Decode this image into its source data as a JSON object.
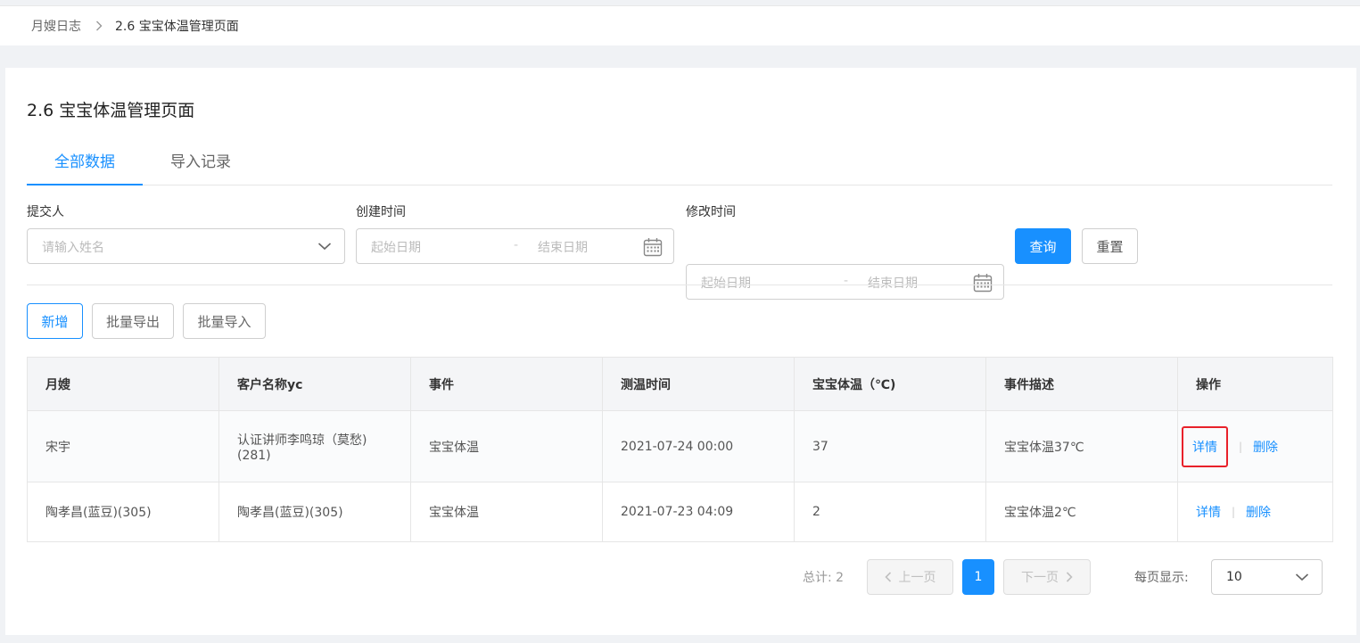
{
  "breadcrumb": {
    "home": "月嫂日志",
    "current": "2.6 宝宝体温管理页面"
  },
  "page": {
    "title": "2.6 宝宝体温管理页面"
  },
  "tabs": [
    {
      "label": "全部数据",
      "active": true
    },
    {
      "label": "导入记录",
      "active": false
    }
  ],
  "filters": {
    "submitter": {
      "label": "提交人",
      "placeholder": "请输入姓名"
    },
    "created": {
      "label": "创建时间",
      "start_placeholder": "起始日期",
      "end_placeholder": "结束日期",
      "separator": "-"
    },
    "modified": {
      "label": "修改时间",
      "start_placeholder": "起始日期",
      "end_placeholder": "结束日期",
      "separator": "-"
    },
    "query_label": "查询",
    "reset_label": "重置"
  },
  "toolbar": {
    "add_label": "新增",
    "export_label": "批量导出",
    "import_label": "批量导入"
  },
  "table": {
    "headers": [
      "月嫂",
      "客户名称yc",
      "事件",
      "测温时间",
      "宝宝体温（℃)",
      "事件描述",
      "操作"
    ],
    "rows": [
      {
        "nanny": "宋宇",
        "customer": "认证讲师李鸣琼（莫愁)(281)",
        "event": "宝宝体温",
        "time": "2021-07-24 00:00",
        "temp": "37",
        "desc": "宝宝体温37℃",
        "detail": "详情",
        "delete": "删除"
      },
      {
        "nanny": "陶孝昌(蓝豆)(305)",
        "customer": "陶孝昌(蓝豆)(305)",
        "event": "宝宝体温",
        "time": "2021-07-23 04:09",
        "temp": "2",
        "desc": "宝宝体温2℃",
        "detail": "详情",
        "delete": "删除"
      }
    ]
  },
  "pagination": {
    "total": "总计: 2",
    "prev": "上一页",
    "current": "1",
    "next": "下一页",
    "per_page_label": "每页显示:",
    "per_page_value": "10"
  },
  "colors": {
    "primary": "#1890ff",
    "highlight": "#e8212a"
  }
}
